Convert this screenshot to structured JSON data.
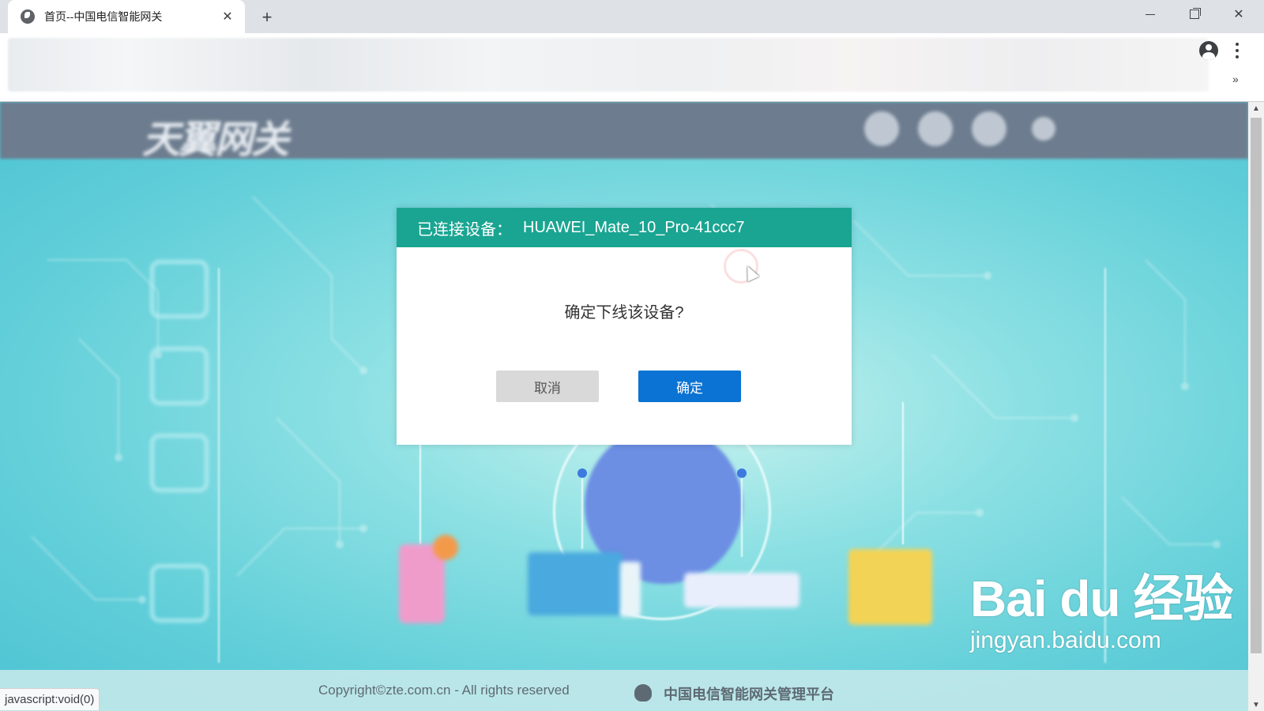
{
  "browser": {
    "tab_title": "首页--中国电信智能网关",
    "tab_close": "✕",
    "new_tab": "+",
    "minimize": "",
    "restore": "",
    "close": "✕",
    "bookmarks_overflow": "»",
    "status_url": "javascript:void(0)"
  },
  "page": {
    "logo_text": "天翼网关",
    "footer_copyright": "Copyright©zte.com.cn - All rights reserved",
    "footer_platform": "中国电信智能网关管理平台"
  },
  "modal": {
    "title_label": "已连接设备：",
    "device_name": "HUAWEI_Mate_10_Pro-41ccc7",
    "message": "确定下线该设备?",
    "cancel_label": "取消",
    "confirm_label": "确定",
    "header_color": "#1aa592",
    "confirm_color": "#0a73d3"
  },
  "watermark": {
    "logo": "Bai du 经验",
    "url": "jingyan.baidu.com"
  }
}
